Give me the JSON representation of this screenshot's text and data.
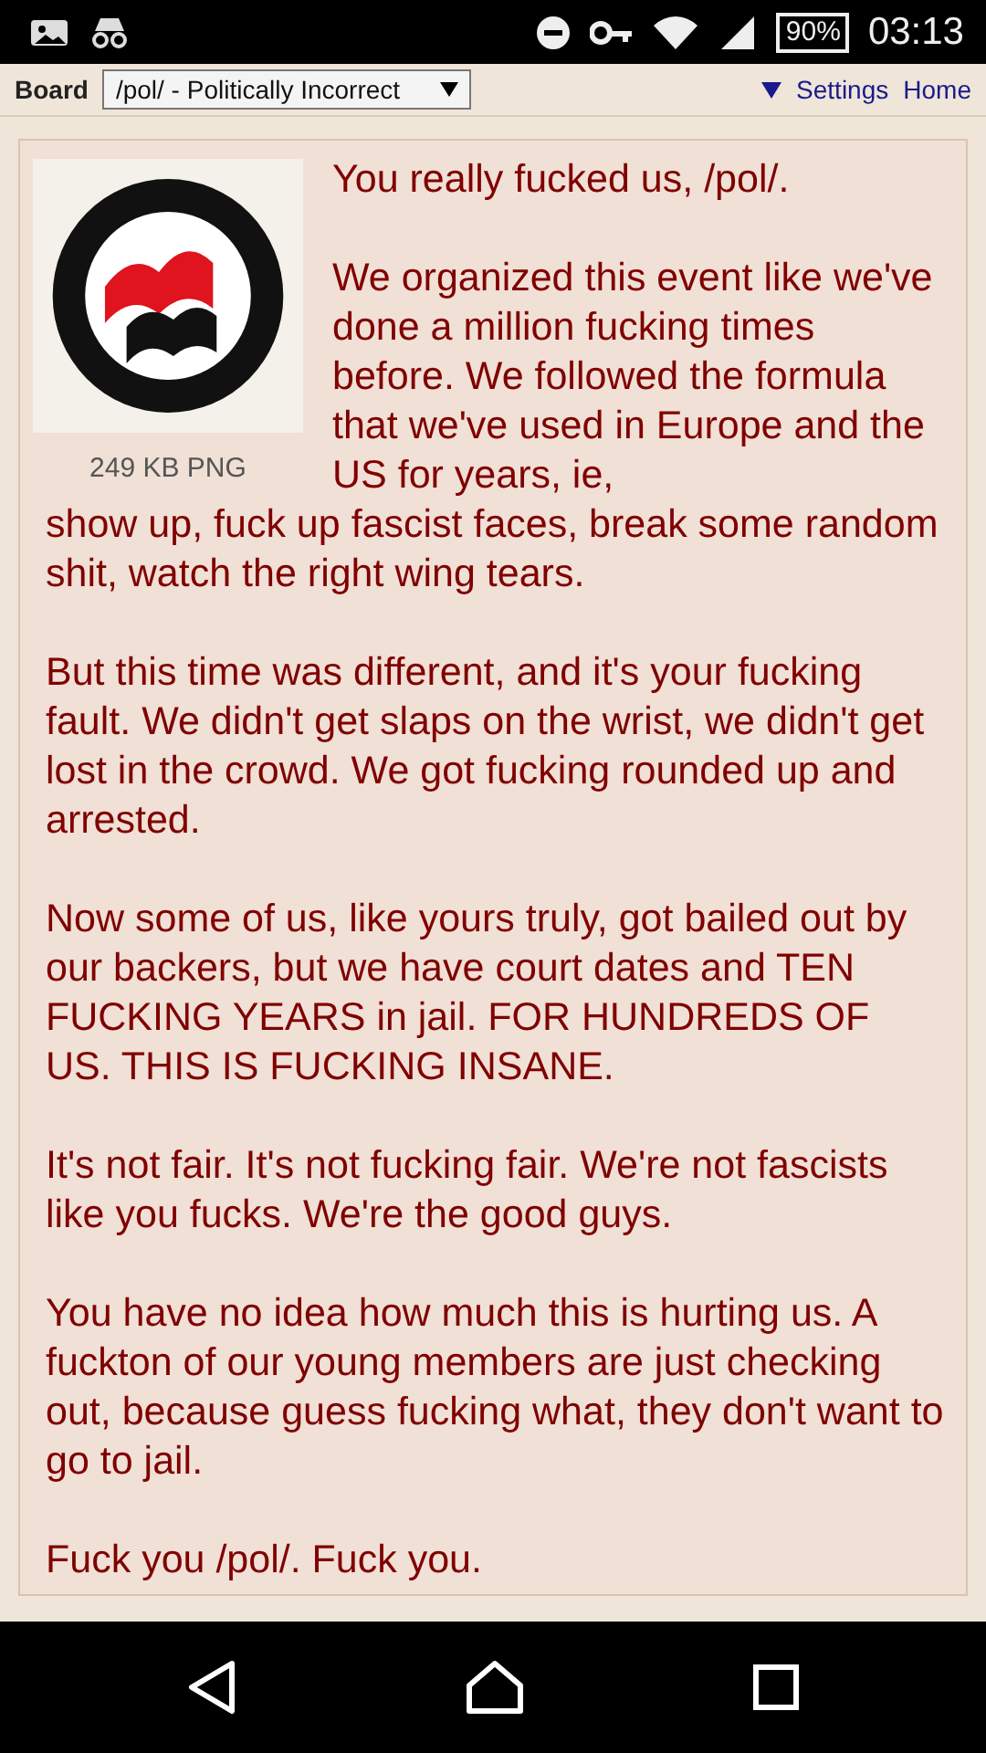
{
  "status_bar": {
    "battery": "90%",
    "time": "03:13"
  },
  "board_bar": {
    "label": "Board",
    "board_select": "/pol/ - Politically Incorrect",
    "links": [
      "Settings",
      "Home"
    ]
  },
  "post": {
    "file_info": "249 KB PNG",
    "side_text": [
      "You really fucked us, /pol/.",
      "We organized this event like we've done a million fucking times before. We followed the formula that we've used in Europe and the US for years, ie,"
    ],
    "paragraphs": [
      "show up, fuck up fascist faces, break some random shit, watch the right wing tears.",
      "But this time was different, and it's your fucking fault. We didn't get slaps on the wrist, we didn't get lost in the crowd. We got fucking rounded up and arrested.",
      "Now some of us, like yours truly, got bailed out by our backers, but we have court dates and TEN FUCKING YEARS in jail. FOR HUNDREDS OF US. THIS IS FUCKING INSANE.",
      "It's not fair. It's not fucking fair. We're not fascists like you fucks. We're the good guys.",
      "You have no idea how much this is hurting us. A fuckton of our young members are just checking out, because guess fucking what, they don't want to go to jail.",
      "Fuck you /pol/. Fuck you."
    ]
  }
}
